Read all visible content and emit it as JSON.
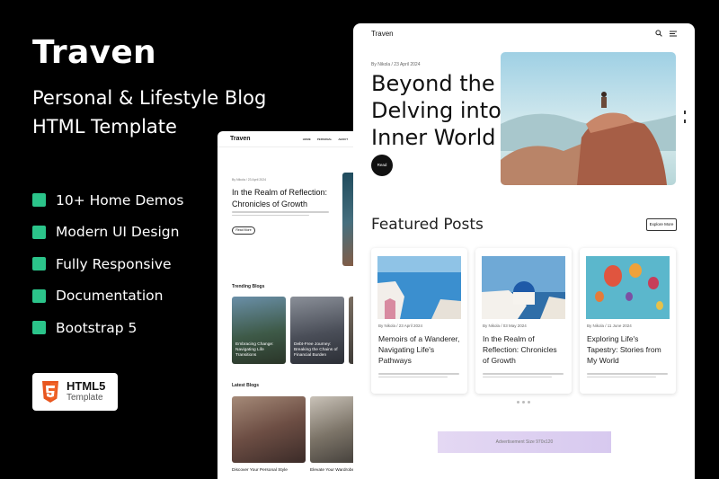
{
  "promo": {
    "brand": "Traven",
    "subtitle_line1": "Personal & Lifestyle Blog",
    "subtitle_line2": "HTML Template",
    "features": [
      "10+ Home Demos",
      "Modern UI Design",
      "Fully Responsive",
      "Documentation",
      "Bootstrap 5"
    ],
    "badge_title": "HTML5",
    "badge_sub": "Template",
    "badge_icon": "html5-icon",
    "accent": "#2bc48a"
  },
  "mock_mid": {
    "logo": "Traven",
    "nav": [
      "HOME",
      "PERSONAL",
      "ABOUT",
      "PA"
    ],
    "meta": "By Nikola / 23 April 2024",
    "title": "In the Realm of Reflection: Chronicles of Growth",
    "button": "Read More",
    "trending_heading": "Trending Blogs",
    "trending": [
      "Embracing Change: Navigating Life Transitions",
      "Debt-Free Journey: Breaking the Chains of Financial Burden"
    ],
    "latest_heading": "Latest Blogs",
    "latest": [
      "Discover Your Personal Style",
      "Elevate Your Wardrobe"
    ]
  },
  "mock_right": {
    "logo": "Traven",
    "meta": "By Nikola / 23 April 2024",
    "title": "Beyond the Surface Delving into My Inner World",
    "read_button": "Read",
    "featured_heading": "Featured Posts",
    "explore_button": "Explore More",
    "posts": [
      {
        "meta": "By Nikola / 23 April 2024",
        "title": "Memoirs of a Wanderer, Navigating Life's Pathways"
      },
      {
        "meta": "By Nikola / 03 May 2024",
        "title": "In the Realm of Reflection: Chronicles of Growth"
      },
      {
        "meta": "By Nikola / 11 June 2024",
        "title": "Exploring Life's Tapestry: Stories from My World"
      }
    ],
    "ad": "Advertisement Size 970x120"
  }
}
